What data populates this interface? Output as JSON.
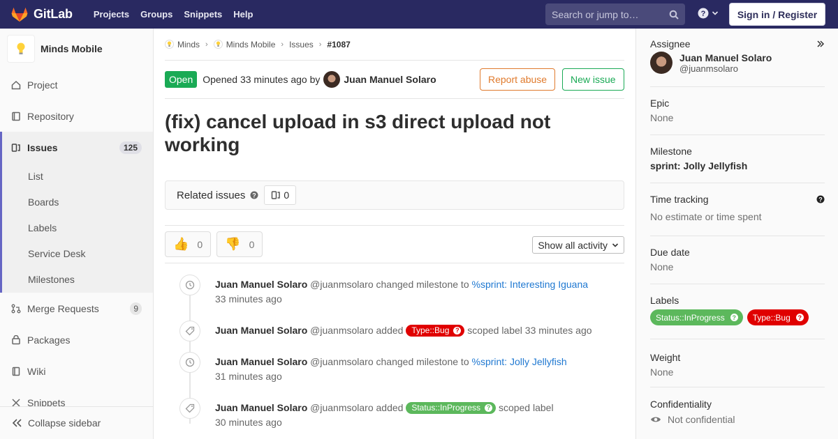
{
  "navbar": {
    "brand": "GitLab",
    "links": [
      "Projects",
      "Groups",
      "Snippets",
      "Help"
    ],
    "search_placeholder": "Search or jump to…",
    "sign_in": "Sign in / Register"
  },
  "sidebar": {
    "project_name": "Minds Mobile",
    "items": {
      "project": "Project",
      "repository": "Repository",
      "issues": "Issues",
      "issues_count": "125",
      "merge_requests": "Merge Requests",
      "merge_requests_count": "9",
      "packages": "Packages",
      "wiki": "Wiki",
      "snippets": "Snippets"
    },
    "issues_sub": [
      "List",
      "Boards",
      "Labels",
      "Service Desk",
      "Milestones"
    ],
    "collapse": "Collapse sidebar"
  },
  "breadcrumb": {
    "items": [
      "Minds",
      "Minds Mobile",
      "Issues",
      "#1087"
    ]
  },
  "issue": {
    "status": "Open",
    "opened_text": "Opened 33 minutes ago by",
    "author": "Juan Manuel Solaro",
    "report_abuse": "Report abuse",
    "new_issue": "New issue",
    "title": "(fix) cancel upload in s3 direct upload not working",
    "related_title": "Related issues",
    "related_count": "0",
    "thumbs_up": "0",
    "thumbs_down": "0",
    "activity_filter": "Show all activity"
  },
  "timeline": [
    {
      "name": "Juan Manuel Solaro",
      "handle": "@juanmsolaro",
      "action": "changed milestone to",
      "link": "%sprint: Interesting Iguana",
      "time": "33 minutes ago",
      "icon": "clock-icon"
    },
    {
      "name": "Juan Manuel Solaro",
      "handle": "@juanmsolaro",
      "action": "added",
      "label": "Type::Bug",
      "suffix": "scoped label",
      "time": "33 minutes ago",
      "icon": "tag-icon"
    },
    {
      "name": "Juan Manuel Solaro",
      "handle": "@juanmsolaro",
      "action": "changed milestone to",
      "link": "%sprint: Jolly Jellyfish",
      "time": "31 minutes ago",
      "icon": "clock-icon"
    },
    {
      "name": "Juan Manuel Solaro",
      "handle": "@juanmsolaro",
      "action": "added",
      "label": "Status::InProgress",
      "suffix": "scoped label",
      "time": "30 minutes ago",
      "icon": "tag-icon"
    }
  ],
  "right_sidebar": {
    "assignee_title": "Assignee",
    "assignee_name": "Juan Manuel Solaro",
    "assignee_handle": "@juanmsolaro",
    "epic_title": "Epic",
    "epic_value": "None",
    "milestone_title": "Milestone",
    "milestone_value": "sprint: Jolly Jellyfish",
    "time_title": "Time tracking",
    "time_value": "No estimate or time spent",
    "due_title": "Due date",
    "due_value": "None",
    "labels_title": "Labels",
    "labels": [
      "Status::InProgress",
      "Type::Bug"
    ],
    "weight_title": "Weight",
    "weight_value": "None",
    "conf_title": "Confidentiality",
    "conf_value": "Not confidential"
  },
  "colors": {
    "navbar": "#292961",
    "open": "#1aaa55",
    "bug_label": "#e00000",
    "progress_label": "#5cb85c",
    "link": "#1f78d1",
    "warning": "#e07a2c"
  }
}
